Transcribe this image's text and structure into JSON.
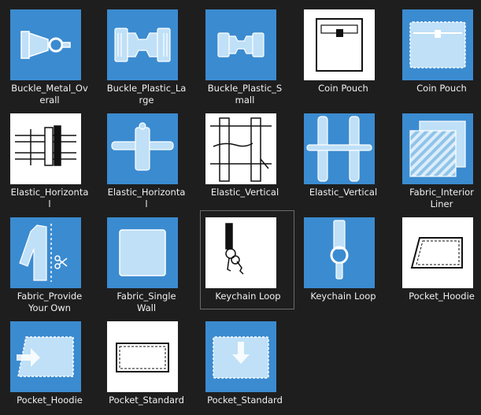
{
  "colors": {
    "background": "#1e1e1e",
    "tile_blue": "#3b8bd0",
    "tile_white": "#ffffff",
    "text": "#f0f0f0"
  },
  "items": [
    {
      "lines": [
        "Buckle_Metal_Ov",
        "erall"
      ],
      "icon": "buckle-metal-icon"
    },
    {
      "lines": [
        "Buckle_Plastic_La",
        "rge"
      ],
      "icon": "buckle-plastic-large-icon"
    },
    {
      "lines": [
        "Buckle_Plastic_S",
        "mall"
      ],
      "icon": "buckle-plastic-small-icon"
    },
    {
      "lines": [
        "Coin Pouch"
      ],
      "icon": "coin-pouch-outline-icon"
    },
    {
      "lines": [
        "Coin Pouch"
      ],
      "icon": "coin-pouch-icon"
    },
    {
      "lines": [
        "Elastic_Horizonta",
        "l"
      ],
      "icon": "elastic-horizontal-outline-icon"
    },
    {
      "lines": [
        "Elastic_Horizonta",
        "l"
      ],
      "icon": "elastic-horizontal-icon"
    },
    {
      "lines": [
        "Elastic_Vertical"
      ],
      "icon": "elastic-vertical-outline-icon"
    },
    {
      "lines": [
        "Elastic_Vertical"
      ],
      "icon": "elastic-vertical-icon"
    },
    {
      "lines": [
        "Fabric_Interior",
        "Liner"
      ],
      "icon": "fabric-interior-liner-icon"
    },
    {
      "lines": [
        "Fabric_Provide",
        "Your Own"
      ],
      "icon": "fabric-provide-your-own-icon"
    },
    {
      "lines": [
        "Fabric_Single",
        "Wall"
      ],
      "icon": "fabric-single-wall-icon"
    },
    {
      "lines": [
        "Keychain Loop"
      ],
      "icon": "keychain-loop-outline-icon"
    },
    {
      "lines": [
        "Keychain Loop"
      ],
      "icon": "keychain-loop-icon"
    },
    {
      "lines": [
        "Pocket_Hoodie"
      ],
      "icon": "pocket-hoodie-outline-icon"
    },
    {
      "lines": [
        "Pocket_Hoodie"
      ],
      "icon": "pocket-hoodie-icon"
    },
    {
      "lines": [
        "Pocket_Standard"
      ],
      "icon": "pocket-standard-outline-icon"
    },
    {
      "lines": [
        "Pocket_Standard"
      ],
      "icon": "pocket-standard-icon"
    }
  ]
}
